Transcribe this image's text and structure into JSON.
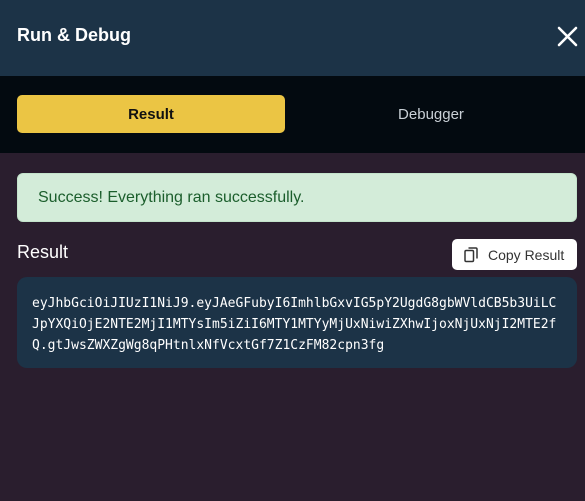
{
  "header": {
    "title": "Run & Debug",
    "close_icon": "close-icon"
  },
  "tabs": [
    {
      "label": "Result",
      "active": true
    },
    {
      "label": "Debugger",
      "active": false
    }
  ],
  "alert": {
    "message": "Success! Everything ran successfully."
  },
  "result": {
    "label": "Result",
    "copy_label": "Copy Result",
    "copy_icon": "copy-icon",
    "value": "eyJhbGciOiJIUzI1NiJ9.eyJAeGFubyI6ImhlbGxvIG5pY2UgdG8gbWVldCB5b3UiLCJpYXQiOjE2NTE2MjI1MTYsIm5iZiI6MTY1MTYyMjUxNiwiZXhwIjoxNjUxNjI2MTE2fQ.gtJwsZWXZgWg8qPHtnlxNfVcxtGf7Z1CzFM82cpn3fg"
  },
  "colors": {
    "header_bg": "#1c3347",
    "tabbar_bg": "#030a10",
    "body_bg": "#2a1e2e",
    "accent": "#ebc544",
    "success_bg": "#d3ecd9",
    "success_text": "#1b5e2c"
  }
}
